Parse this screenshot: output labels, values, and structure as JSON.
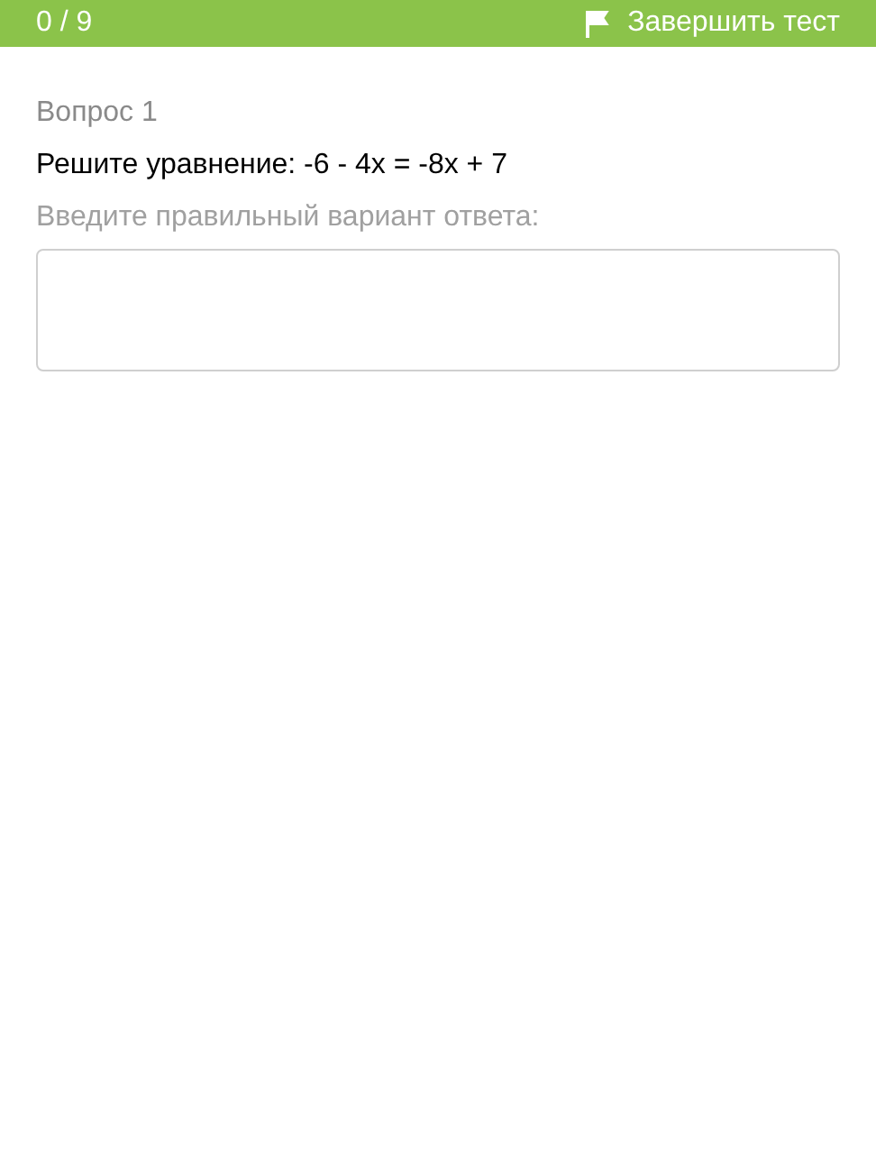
{
  "header": {
    "progress": "0 / 9",
    "finish_button": "Завершить тест"
  },
  "question": {
    "number": "Вопрос 1",
    "text": "Решите уравнение: -6 - 4x = -8x + 7",
    "prompt": "Введите правильный вариант ответа:"
  }
}
